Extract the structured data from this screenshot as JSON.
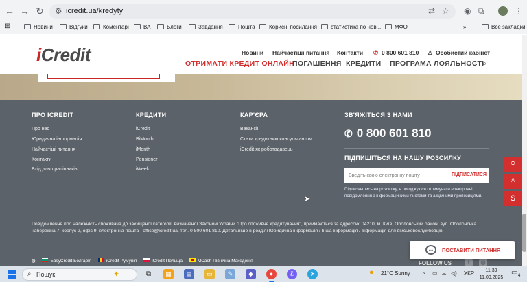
{
  "browser": {
    "url": "icredit.ua/kredyty",
    "bookmarks": [
      "Новини",
      "Відгуки",
      "Коментарі",
      "ВА",
      "Блоги",
      "Завдання",
      "Пошта",
      "Корисні посилання",
      "статистика по нов...",
      "МФО"
    ],
    "all_bookmarks": "Все закладки"
  },
  "header": {
    "logo_i": "i",
    "logo_rest": "Credit",
    "top_links": [
      "Новини",
      "Найчастіші питання",
      "Контакти"
    ],
    "phone": "0 800 601 810",
    "cabinet": "Особистий кабінет",
    "main_nav": [
      "ОТРИМАТИ КРЕДИТ ОНЛАЙН",
      "ПОГАШЕННЯ",
      "КРЕДИТИ",
      "ПРОГРАМА ЛОЯЛЬНОСТІ"
    ],
    "separator": "|"
  },
  "footer": {
    "col1": {
      "title": "ПРО ICREDIT",
      "links": [
        "Про нас",
        "Юридична інформація",
        "Найчастіші питання",
        "Контакти",
        "Вхід для працівників"
      ]
    },
    "col2": {
      "title": "КРЕДИТИ",
      "links": [
        "iCredit",
        "BiMonth",
        "iMonth",
        "Pensioner",
        "iWeek"
      ]
    },
    "col3": {
      "title": "КАР'ЄРА",
      "links": [
        "Вакансії",
        "Стати кредитним консультантом",
        "iCredit як роботодавець"
      ]
    },
    "contact": {
      "title": "ЗВ'ЯЖІТЬСЯ З НАМИ",
      "phone": "0 800 601 810"
    },
    "subscribe": {
      "title": "ПІДПИШІТЬСЯ НА НАШУ РОЗСИЛКУ",
      "placeholder": "Введіть свою електронну пошту",
      "button": "ПІДПИСАТИСЯ",
      "consent": "Підписавшись на розсилку, я погоджуюся отримувати електронні повідомлення з інформаційними листами та акційними пропозиціями."
    },
    "notice": "Повідомлення про належність споживача до захищеної категорії, визначеної Законом України \"Про споживче кредитування\", приймаються за адресою: 04210, м. Київ, Оболонський район, вул. Оболонська набережна 7, корпус 2, офіс 9, електронна пошта - office@icredit.ua, тел. 0 800 601 810. Детальніше в розділі Юридична інформація / Інша інформація / Інформація для військовослужбовців.",
    "countries": [
      "EasyCredit Болгарія",
      "iCredit Румунія",
      "iCredit Польща",
      "MCash Північна Македонія"
    ],
    "follow": "FOLLOW US",
    "ask_button": "ПОСТАВИТИ ПИТАННЯ"
  },
  "taskbar": {
    "search": "Пошук",
    "weather": "21°C  Sunny",
    "lang": "УКР",
    "time": "11:39",
    "date": "11.09.2025",
    "notifications": "4"
  }
}
